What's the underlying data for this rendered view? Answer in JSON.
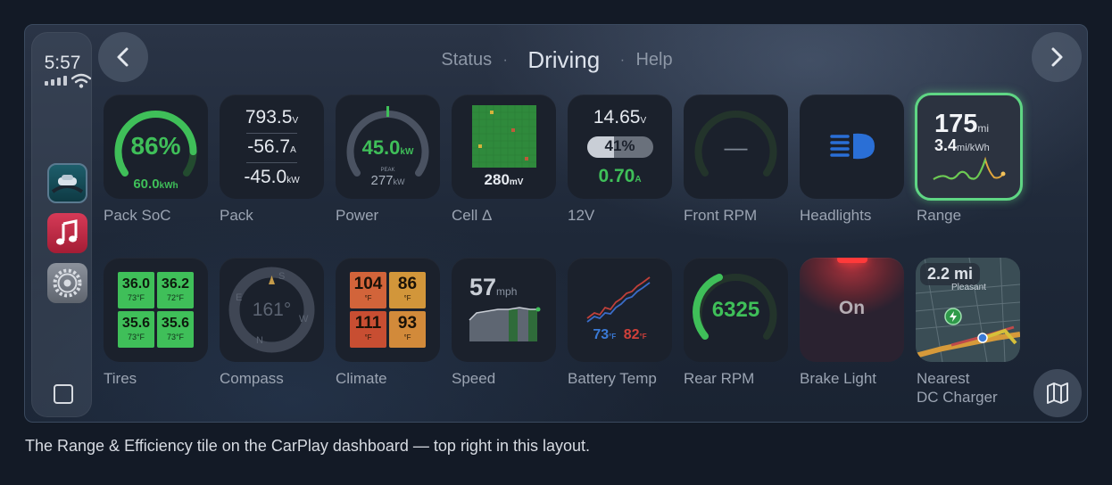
{
  "status_bar": {
    "time": "5:57"
  },
  "header": {
    "tab_left": "Status",
    "tab_active": "Driving",
    "tab_right": "Help",
    "separator": "·"
  },
  "tiles": {
    "pack_soc": {
      "label": "Pack SoC",
      "percent": "86%",
      "energy": "60.0",
      "energy_unit": "kWh",
      "level": 0.86
    },
    "pack": {
      "label": "Pack",
      "voltage": "793.5",
      "voltage_unit": "V",
      "current": "-56.7",
      "current_unit": "A",
      "power": "-45.0",
      "power_unit": "kW"
    },
    "power": {
      "label": "Power",
      "value": "45.0",
      "unit": "kW",
      "peak_label": "PEAK",
      "peak": "277",
      "peak_unit": "kW"
    },
    "cell_delta": {
      "label": "Cell Δ",
      "value": "280",
      "unit": "mV"
    },
    "twelve_v": {
      "label": "12V",
      "voltage": "14.65",
      "voltage_unit": "V",
      "percent": "41%",
      "current": "0.70",
      "current_unit": "A",
      "level": 0.41
    },
    "front_rpm": {
      "label": "Front RPM",
      "value": "—"
    },
    "headlights": {
      "label": "Headlights"
    },
    "range": {
      "label": "Range",
      "distance": "175",
      "distance_unit": "mi",
      "efficiency": "3.4",
      "efficiency_unit": "mi/kWh"
    },
    "tires": {
      "label": "Tires",
      "cells": [
        {
          "pressure": "36.0",
          "temp": "73°F"
        },
        {
          "pressure": "36.2",
          "temp": "72°F"
        },
        {
          "pressure": "35.6",
          "temp": "73°F"
        },
        {
          "pressure": "35.6",
          "temp": "73°F"
        }
      ]
    },
    "compass": {
      "label": "Compass",
      "heading": "161°",
      "n": "N",
      "s": "S",
      "e": "E",
      "w": "W"
    },
    "climate": {
      "label": "Climate",
      "cells": [
        {
          "temp": "104",
          "unit": "°F"
        },
        {
          "temp": "86",
          "unit": "°F"
        },
        {
          "temp": "111",
          "unit": "°F"
        },
        {
          "temp": "93",
          "unit": "°F"
        }
      ]
    },
    "speed": {
      "label": "Speed",
      "value": "57",
      "unit": "mph"
    },
    "battery_temp": {
      "label": "Battery Temp",
      "low": "73",
      "high": "82",
      "unit": "°F"
    },
    "rear_rpm": {
      "label": "Rear RPM",
      "value": "6325"
    },
    "brake_light": {
      "label": "Brake Light",
      "state": "On"
    },
    "charger": {
      "label_line1": "Nearest",
      "label_line2": "DC Charger",
      "distance": "2.2 mi",
      "map_text": "Pleasant"
    }
  },
  "caption": "The Range & Efficiency tile on the CarPlay dashboard — top right in this layout.",
  "colors": {
    "accent_green": "#3fbf59",
    "highlight_border": "#5fd684",
    "headlight_blue": "#2a6fd6",
    "brake_red": "#c0303a"
  }
}
